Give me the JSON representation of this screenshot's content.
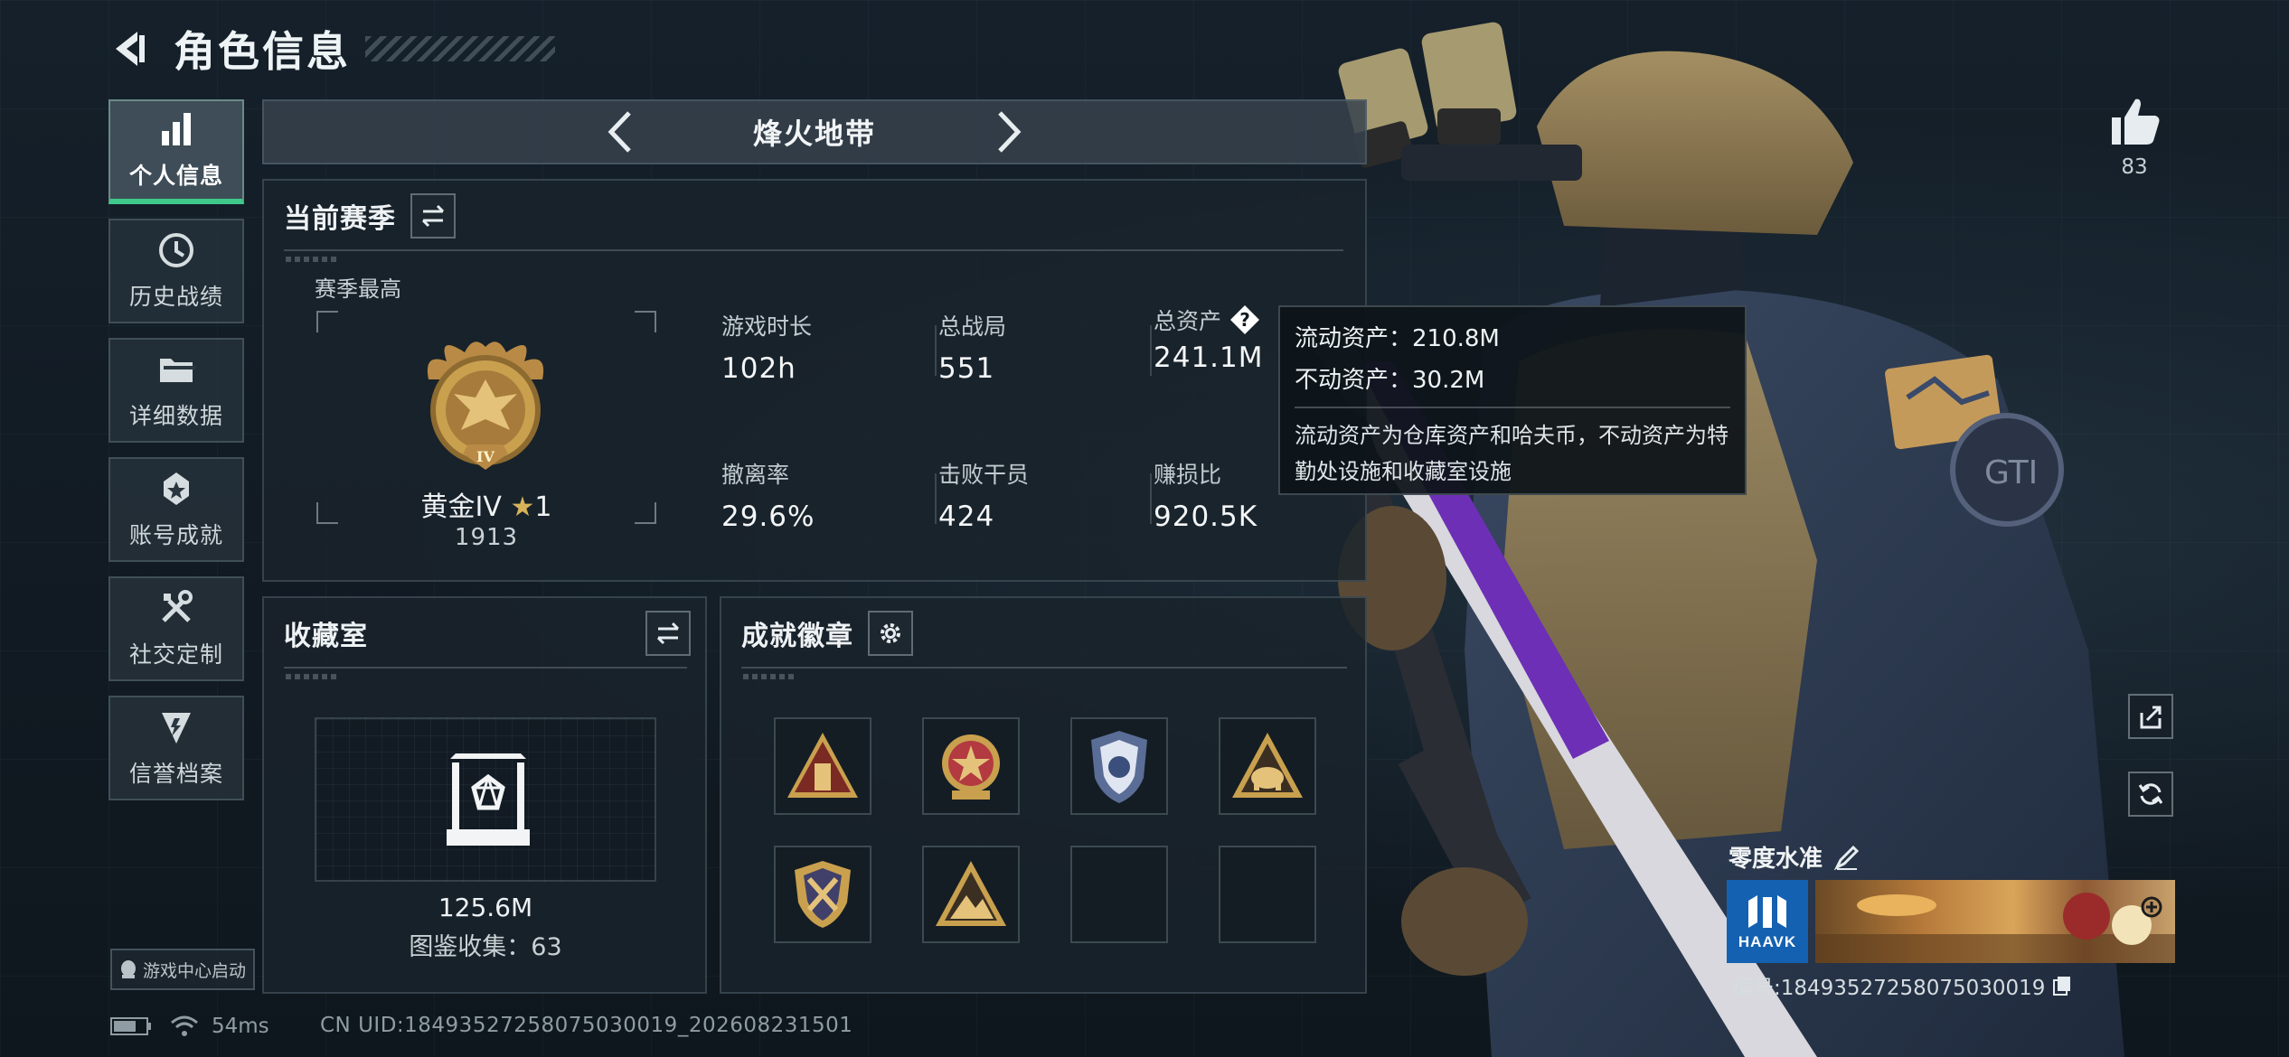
{
  "header": {
    "title": "角色信息"
  },
  "sidebar": {
    "items": [
      {
        "label": "个人信息",
        "icon": "bar-chart-icon",
        "active": true
      },
      {
        "label": "历史战绩",
        "icon": "clock-icon",
        "active": false
      },
      {
        "label": "详细数据",
        "icon": "folder-icon",
        "active": false
      },
      {
        "label": "账号成就",
        "icon": "achievement-icon",
        "active": false
      },
      {
        "label": "社交定制",
        "icon": "tools-icon",
        "active": false
      },
      {
        "label": "信誉档案",
        "icon": "credit-icon",
        "active": false
      }
    ],
    "game_center": "游戏中心启动"
  },
  "mode": {
    "label": "烽火地带"
  },
  "season": {
    "title": "当前赛季",
    "best_label": "赛季最高",
    "rank_name": "黄金IV",
    "rank_star": "★",
    "rank_stars": "1",
    "rank_score": "1913",
    "rank_badge_numeral": "IV",
    "stats": [
      {
        "label": "游戏时长",
        "value": "102h"
      },
      {
        "label": "总战局",
        "value": "551"
      },
      {
        "label": "总资产",
        "value": "241.1M"
      },
      {
        "label": "撤离率",
        "value": "29.6%"
      },
      {
        "label": "击败干员",
        "value": "424"
      },
      {
        "label": "赚损比",
        "value": "920.5K"
      }
    ]
  },
  "tooltip": {
    "line1": "流动资产：210.8M",
    "line2": "不动资产：30.2M",
    "desc": "流动资产为仓库资产和哈夫币，不动资产为特勤处设施和收藏室设施"
  },
  "collection": {
    "title": "收藏室",
    "value": "125.6M",
    "count": "图鉴收集：63"
  },
  "badges": {
    "title": "成就徽章",
    "slots": [
      {
        "icon": "triangle-tower-badge-icon",
        "filled": true
      },
      {
        "icon": "star-medal-badge-icon",
        "filled": true
      },
      {
        "icon": "police-shield-badge-icon",
        "filled": true
      },
      {
        "icon": "elephant-triangle-badge-icon",
        "filled": true
      },
      {
        "icon": "crossed-swords-shield-badge-icon",
        "filled": true
      },
      {
        "icon": "mountain-triangle-badge-icon",
        "filled": true
      },
      {
        "icon": "empty-slot",
        "filled": false
      },
      {
        "icon": "empty-slot",
        "filled": false
      }
    ]
  },
  "player": {
    "likes": "83",
    "name": "零度水准",
    "brand": "HAAVK",
    "id_text": "编号:18493527258075030019"
  },
  "status": {
    "ping": "54ms",
    "uid": "CN UID:18493527258075030019_202608231501"
  },
  "colors": {
    "accent_green": "#3ec98a",
    "gold": "#c9a04e",
    "brand_blue": "#1561b1"
  }
}
